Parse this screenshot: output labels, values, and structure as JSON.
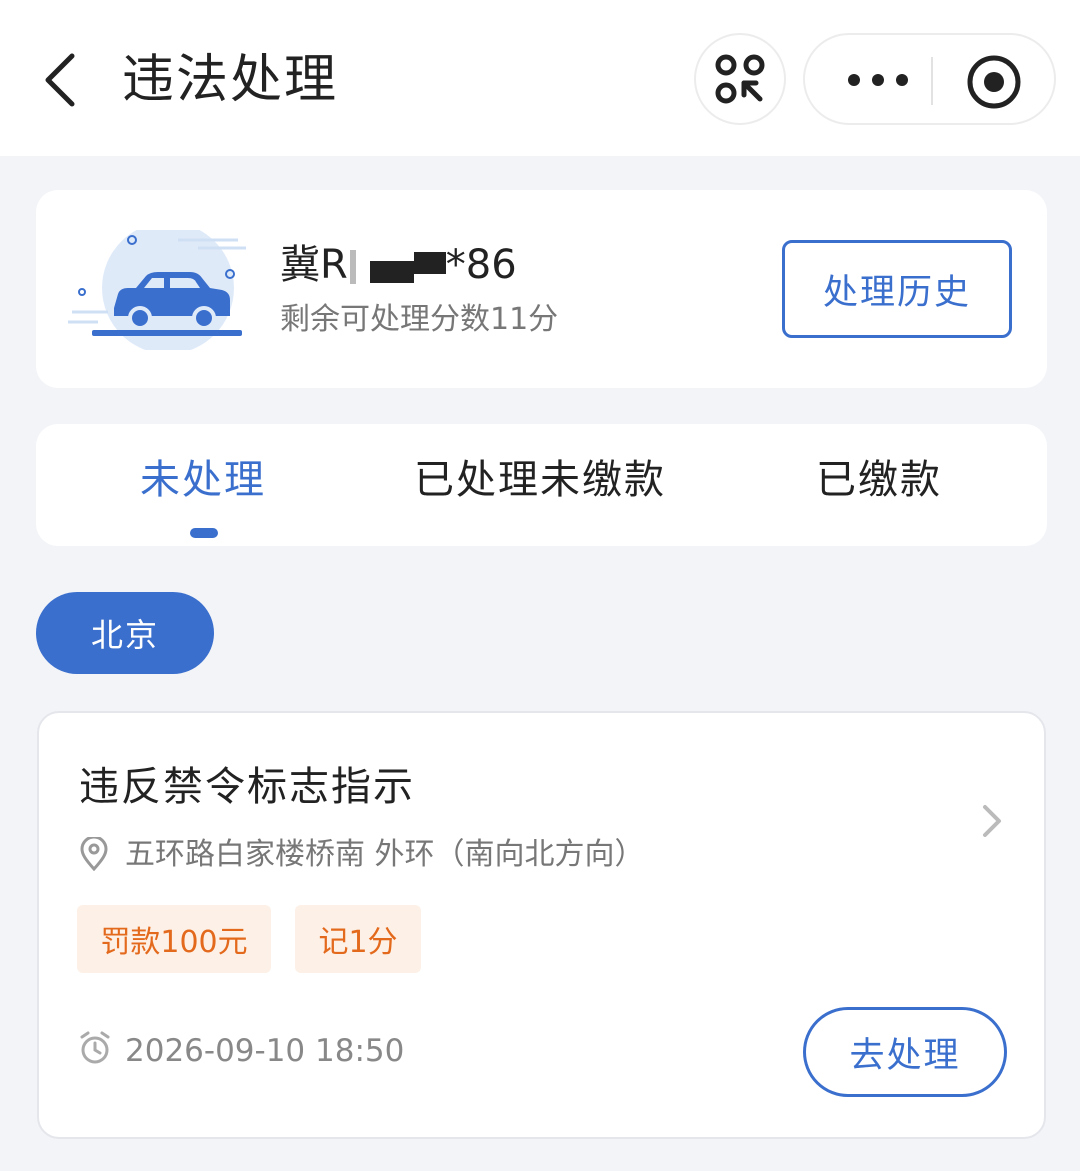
{
  "header": {
    "title": "违法处理",
    "back_icon": "chevron-left-icon",
    "scan_icon": "scan-icon",
    "more_icon": "more-dots-icon",
    "close_icon": "close-target-icon"
  },
  "vehicle": {
    "plate_prefix": "冀R",
    "plate_suffix": "*86",
    "points_text": "剩余可处理分数11分",
    "history_label": "处理历史"
  },
  "tabs": [
    {
      "label": "未处理",
      "active": true
    },
    {
      "label": "已处理未缴款",
      "active": false
    },
    {
      "label": "已缴款",
      "active": false
    }
  ],
  "city_filter": "北京",
  "violation": {
    "title": "违反禁令标志指示",
    "location": "五环路白家楼桥南 外环（南向北方向）",
    "fine_tag": "罚款100元",
    "points_tag": "记1分",
    "time": "2026-09-10 18:50",
    "action_label": "去处理"
  },
  "colors": {
    "accent": "#3a6fce",
    "tag_bg": "#fdf0e6",
    "tag_text": "#e36a1d",
    "page_bg": "#f3f4f8"
  }
}
